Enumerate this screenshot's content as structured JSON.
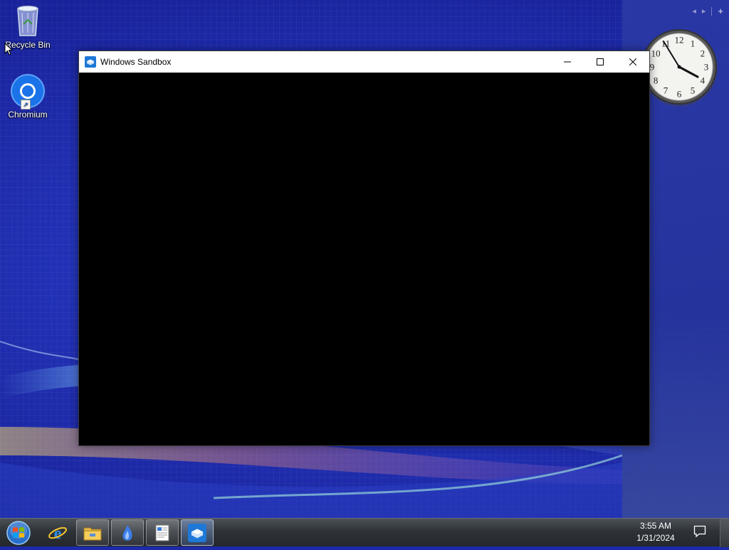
{
  "desktop": {
    "icons": [
      {
        "label": "Recycle Bin",
        "icon": "recycle-bin-icon"
      },
      {
        "label": "Chromium",
        "icon": "chromium-icon"
      }
    ],
    "sidebar_controls": {
      "prev": "◂",
      "next": "▸",
      "add": "+"
    }
  },
  "window": {
    "title": "Windows Sandbox",
    "icon": "windows-sandbox-icon",
    "minimize_glyph": "minimize-icon",
    "maximize_glyph": "maximize-icon",
    "close_glyph": "close-icon",
    "content_color": "#000000"
  },
  "clock_gadget": {
    "numerals": [
      "12",
      "1",
      "2",
      "3",
      "4",
      "5",
      "6",
      "7",
      "8",
      "9",
      "10",
      "11"
    ],
    "time": "3:55"
  },
  "taskbar": {
    "pinned": [
      {
        "name": "internet-explorer",
        "icon": "ie-icon"
      },
      {
        "name": "file-explorer",
        "icon": "folder-icon"
      },
      {
        "name": "app-blue",
        "icon": "blue-flame-icon"
      },
      {
        "name": "wordpad",
        "icon": "document-icon"
      },
      {
        "name": "windows-sandbox",
        "icon": "windows-sandbox-icon",
        "state": "running"
      }
    ],
    "time": "3:55 AM",
    "date": "1/31/2024"
  },
  "colors": {
    "wallpaper": "#2232b8",
    "titlebar": "#ffffff",
    "window_content": "#000000",
    "taskbar": "#2e3338"
  }
}
